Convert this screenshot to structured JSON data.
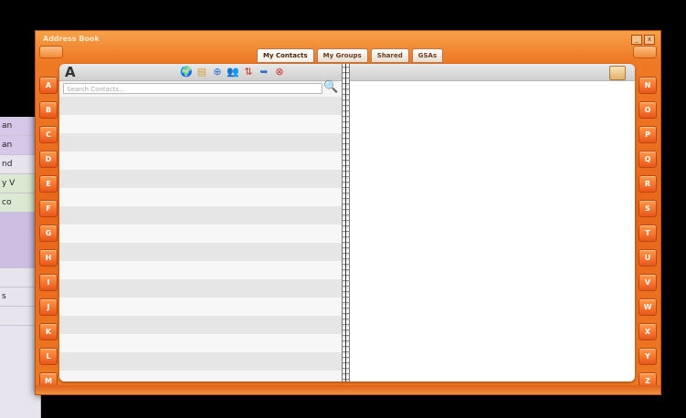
{
  "background": {
    "strips": [
      "an",
      "an",
      "nd",
      "y V",
      "co",
      "",
      "",
      "s",
      ""
    ]
  },
  "window": {
    "title": "Address Book",
    "controls": [
      "_",
      "x"
    ],
    "corner_left": "",
    "corner_right": ""
  },
  "tabs": [
    "My Contacts",
    "My Groups",
    "Shared",
    "GSAs"
  ],
  "letters_left": [
    "A",
    "B",
    "C",
    "D",
    "E",
    "F",
    "G",
    "H",
    "I",
    "J",
    "K",
    "L",
    "M"
  ],
  "letters_right": [
    "N",
    "O",
    "P",
    "Q",
    "R",
    "S",
    "T",
    "U",
    "V",
    "W",
    "X",
    "Y",
    "Z"
  ],
  "left_page": {
    "section_letter": "A",
    "search_placeholder": "Search Contacts...",
    "toolbar_icons": [
      "globe-icon",
      "notebook-icon",
      "add-contact-icon",
      "contacts-icon",
      "import-icon",
      "export-icon",
      "delete-icon"
    ],
    "row_count": 15
  },
  "colors": {
    "accent": "#ec6a1c",
    "page": "#ffffff"
  }
}
